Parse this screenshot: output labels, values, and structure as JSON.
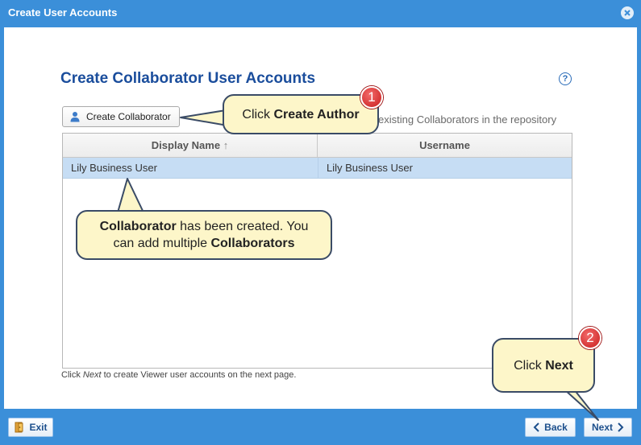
{
  "window": {
    "title": "Create User Accounts"
  },
  "page": {
    "heading": "Create Collaborator User Accounts"
  },
  "toolbar": {
    "create_button_label": "Create Collaborator",
    "info_text": "existing Collaborators in the repository"
  },
  "grid": {
    "columns": [
      "Display Name",
      "Username"
    ],
    "sort_indicator": "↑",
    "rows": [
      [
        "Lily Business User",
        "Lily Business User"
      ]
    ]
  },
  "footnote": {
    "prefix": "Click ",
    "emph": "Next",
    "suffix": " to create Viewer user accounts on the next page."
  },
  "buttons": {
    "exit": "Exit",
    "back": "Back",
    "next": "Next"
  },
  "callouts": {
    "c1_plain": "Click ",
    "c1_bold": "Create Author",
    "c1_badge": "1",
    "c2_bold1": "Collaborator",
    "c2_plain1": " has been created. You can add multiple ",
    "c2_bold2": "Collaborators",
    "c3_plain": "Click ",
    "c3_bold": "Next",
    "c3_badge": "2"
  },
  "icons": {
    "close": "close-icon",
    "help": "help-icon",
    "user": "user-icon",
    "exit": "exit-door-icon",
    "back": "chevron-left-icon",
    "next": "chevron-right-icon"
  },
  "colors": {
    "frame": "#3b8fd9",
    "heading": "#1a4d9c",
    "selected_row": "#c6ddf4",
    "callout_fill": "#fdf6c9",
    "badge": "#d42a2a"
  }
}
